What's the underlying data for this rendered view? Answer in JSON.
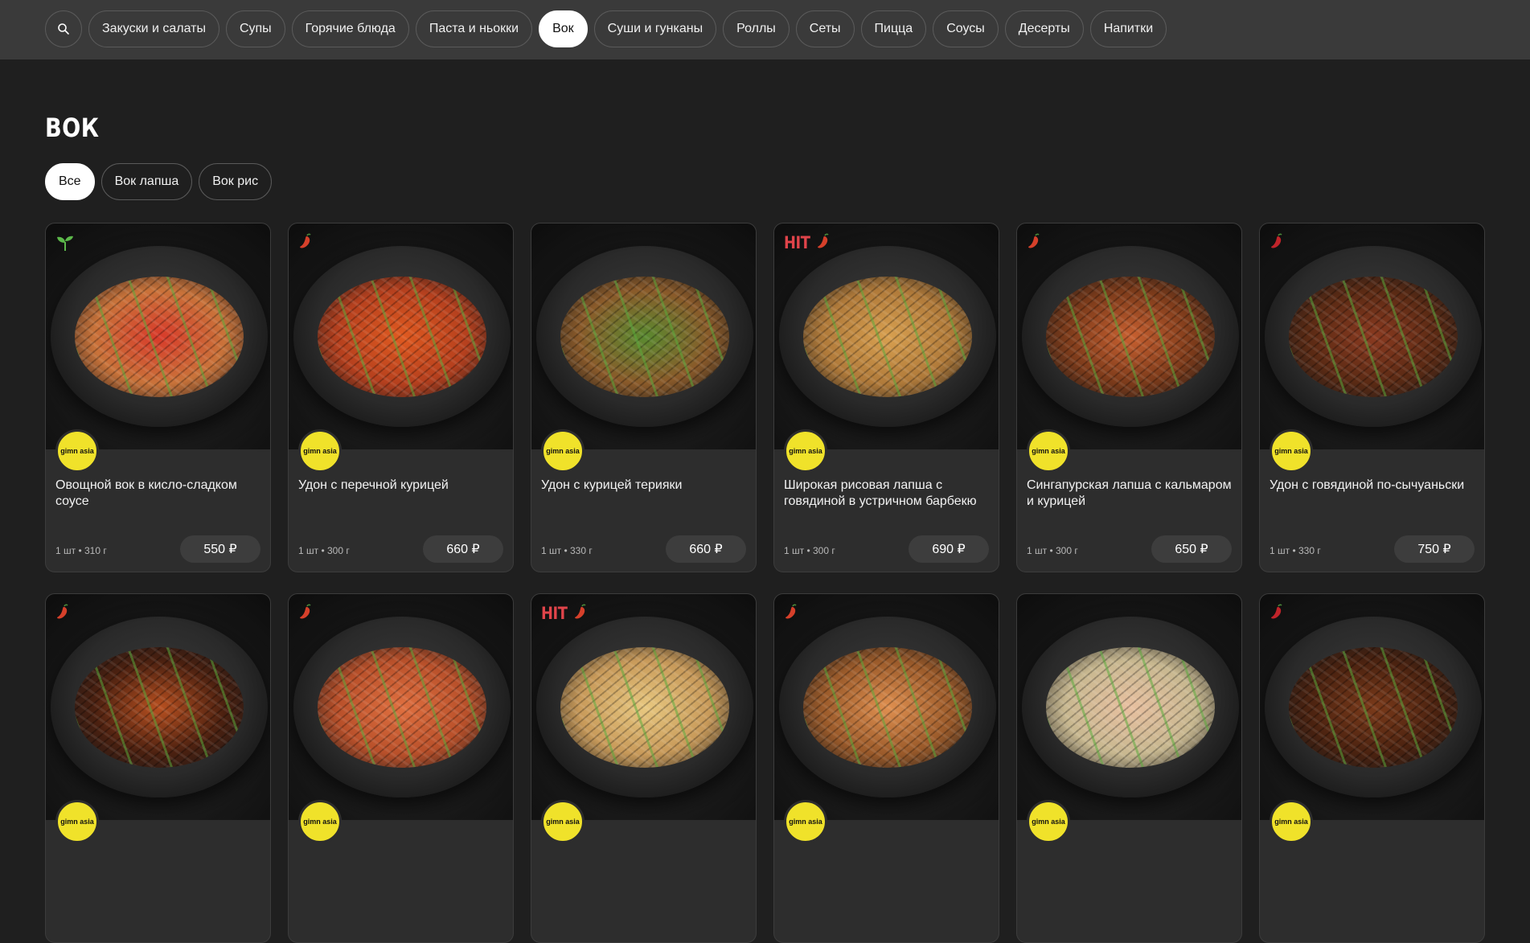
{
  "nav": {
    "search_icon": "search-icon",
    "items": [
      {
        "label": "Закуски и салаты"
      },
      {
        "label": "Супы"
      },
      {
        "label": "Горячие блюда"
      },
      {
        "label": "Паста и ньокки"
      },
      {
        "label": "Вок",
        "active": true
      },
      {
        "label": "Суши и гунканы"
      },
      {
        "label": "Роллы"
      },
      {
        "label": "Сеты"
      },
      {
        "label": "Пицца"
      },
      {
        "label": "Соусы"
      },
      {
        "label": "Десерты"
      },
      {
        "label": "Напитки"
      }
    ]
  },
  "section": {
    "title": "ВОК",
    "filters": [
      {
        "label": "Все",
        "active": true
      },
      {
        "label": "Вок лапша"
      },
      {
        "label": "Вок рис"
      }
    ]
  },
  "brand_logo_text": "gimn asia",
  "colors": {
    "background": "#1f1f1f",
    "topbar": "#3a3a3a",
    "card": "#2d2d2d",
    "hit": "#e0444a",
    "brand_yellow": "#f0e22a"
  },
  "products": [
    {
      "name": "Овощной вок в кисло-сладком соусе",
      "meta": "1 шт • 310 г",
      "price": "550 ₽",
      "badge": "sprout",
      "hit": "",
      "food_color": "#c9733a",
      "accent": "#d83a2a"
    },
    {
      "name": "Удон с перечной курицей",
      "meta": "1 шт • 300 г",
      "price": "660 ₽",
      "badge": "chili",
      "hit": "",
      "food_color": "#b5401e",
      "accent": "#e05a20"
    },
    {
      "name": "Удон с курицей терияки",
      "meta": "1 шт • 330 г",
      "price": "660 ₽",
      "badge": "",
      "hit": "",
      "food_color": "#8a5a2a",
      "accent": "#5a8a30"
    },
    {
      "name": "Широкая рисовая лапша с говядиной в устричном барбекю",
      "meta": "1 шт • 300 г",
      "price": "690 ₽",
      "badge": "chili",
      "hit": "HIT",
      "food_color": "#b07a3a",
      "accent": "#d8a050"
    },
    {
      "name": "Сингапурская лапша с кальмаром и курицей",
      "meta": "1 шт • 300 г",
      "price": "650 ₽",
      "badge": "chili",
      "hit": "",
      "food_color": "#7a3a1a",
      "accent": "#c86030"
    },
    {
      "name": "Удон с говядиной по-сычуаньски",
      "meta": "1 шт • 330 г",
      "price": "750 ₽",
      "badge": "chili-hot",
      "hit": "",
      "food_color": "#5a2a14",
      "accent": "#8a3a20"
    },
    {
      "name": "",
      "meta": "",
      "price": "",
      "badge": "chili",
      "hit": "",
      "food_color": "#4a2010",
      "accent": "#b85020"
    },
    {
      "name": "",
      "meta": "",
      "price": "",
      "badge": "chili",
      "hit": "",
      "food_color": "#b8502a",
      "accent": "#e07040"
    },
    {
      "name": "",
      "meta": "",
      "price": "",
      "badge": "chili",
      "hit": "HIT",
      "food_color": "#c89a5a",
      "accent": "#e8c880"
    },
    {
      "name": "",
      "meta": "",
      "price": "",
      "badge": "chili",
      "hit": "",
      "food_color": "#9a5a2a",
      "accent": "#e09050"
    },
    {
      "name": "",
      "meta": "",
      "price": "",
      "badge": "",
      "hit": "",
      "food_color": "#c8b890",
      "accent": "#e8c0a0"
    },
    {
      "name": "",
      "meta": "",
      "price": "",
      "badge": "chili-hot",
      "hit": "",
      "food_color": "#4a2210",
      "accent": "#7a3a1a"
    }
  ]
}
